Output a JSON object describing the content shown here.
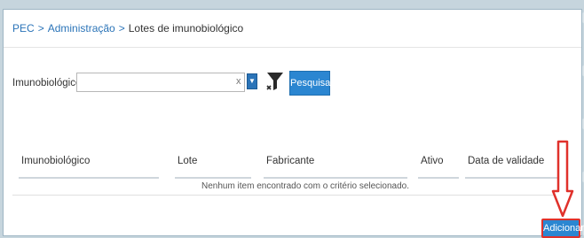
{
  "breadcrumb": {
    "items": [
      "PEC",
      "Administração",
      "Lotes de imunobiológico"
    ],
    "separator": ">"
  },
  "filter": {
    "label": "Imunobiológico",
    "value": "",
    "placeholder": "",
    "clear_label": "x",
    "search_label": "Pesquisar"
  },
  "table": {
    "columns": [
      "Imunobiológico",
      "Lote",
      "Fabricante",
      "Ativo",
      "Data de validade"
    ],
    "empty_message": "Nenhum item encontrado com o critério selecionado."
  },
  "actions": {
    "add_label": "Adicionar"
  },
  "colors": {
    "link": "#2b74b8",
    "button": "#2b86d1",
    "highlight": "#e0312b"
  }
}
